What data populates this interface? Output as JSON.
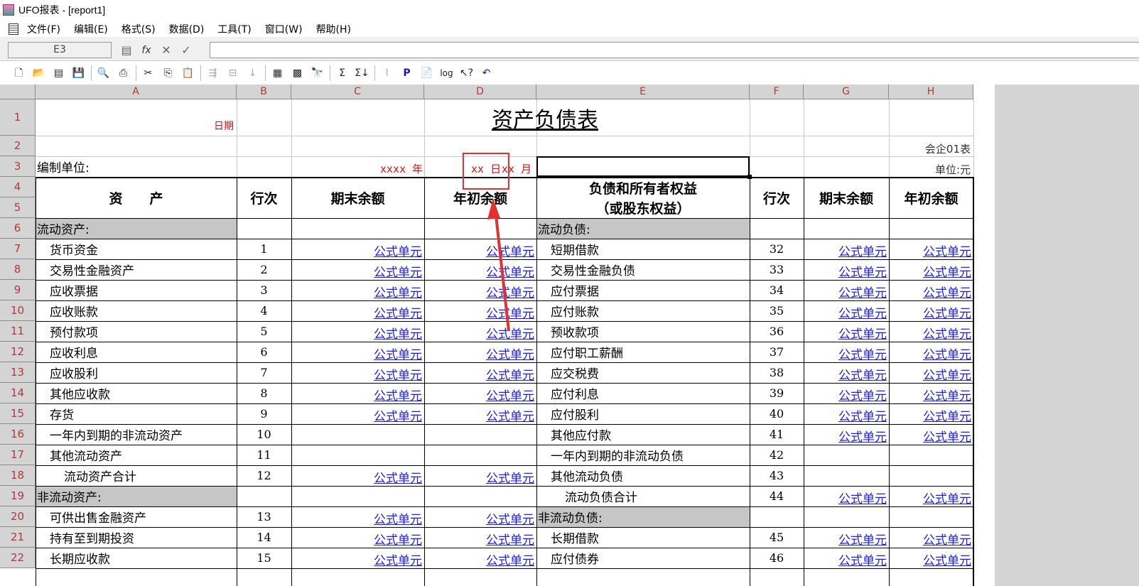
{
  "window": {
    "title": "UFO报表 - [report1]"
  },
  "menu": [
    "文件(F)",
    "编辑(E)",
    "格式(S)",
    "数据(D)",
    "工具(T)",
    "窗口(W)",
    "帮助(H)"
  ],
  "formula_bar": {
    "cell_ref": "E3",
    "fx": "fx",
    "value": ""
  },
  "columns": [
    "A",
    "B",
    "C",
    "D",
    "E",
    "F",
    "G",
    "H"
  ],
  "rows": [
    "1",
    "2",
    "3",
    "4",
    "5",
    "6",
    "7",
    "8",
    "9",
    "10",
    "11",
    "12",
    "13",
    "14",
    "15",
    "16",
    "17",
    "18",
    "19",
    "20",
    "21",
    "22"
  ],
  "report": {
    "title": "资产负债表",
    "date_label": "日期",
    "form_no": "会企01表",
    "unit_label": "编制单位:",
    "currency_unit": "单位:元",
    "date_parts": [
      "xxxx 年",
      "xx 日",
      "xx 月"
    ],
    "headers": {
      "assets": "资　　产",
      "row_no": "行次",
      "end_balance": "期末余额",
      "begin_balance": "年初余额",
      "liab_line1": "负债和所有者权益",
      "liab_line2": "（或股东权益）"
    },
    "formula_text": "公式单元",
    "left_items": [
      {
        "name": "流动资产:",
        "no": "",
        "f": false,
        "sec": true
      },
      {
        "name": "货币资金",
        "no": "1",
        "f": true
      },
      {
        "name": "交易性金融资产",
        "no": "2",
        "f": true
      },
      {
        "name": "应收票据",
        "no": "3",
        "f": true
      },
      {
        "name": "应收账款",
        "no": "4",
        "f": true
      },
      {
        "name": "预付款项",
        "no": "5",
        "f": true
      },
      {
        "name": "应收利息",
        "no": "6",
        "f": true
      },
      {
        "name": "应收股利",
        "no": "7",
        "f": true
      },
      {
        "name": "其他应收款",
        "no": "8",
        "f": true
      },
      {
        "name": "存货",
        "no": "9",
        "f": true
      },
      {
        "name": "一年内到期的非流动资产",
        "no": "10",
        "f": false
      },
      {
        "name": "其他流动资产",
        "no": "11",
        "f": false
      },
      {
        "name": "流动资产合计",
        "no": "12",
        "f": true,
        "indent2": true
      },
      {
        "name": "非流动资产:",
        "no": "",
        "f": false,
        "sec": true
      },
      {
        "name": "可供出售金融资产",
        "no": "13",
        "f": true
      },
      {
        "name": "持有至到期投资",
        "no": "14",
        "f": true
      },
      {
        "name": "长期应收款",
        "no": "15",
        "f": true
      }
    ],
    "right_items": [
      {
        "name": "流动负债:",
        "no": "",
        "f": false,
        "sec": true
      },
      {
        "name": "短期借款",
        "no": "32",
        "f": true
      },
      {
        "name": "交易性金融负债",
        "no": "33",
        "f": true
      },
      {
        "name": "应付票据",
        "no": "34",
        "f": true
      },
      {
        "name": "应付账款",
        "no": "35",
        "f": true
      },
      {
        "name": "预收款项",
        "no": "36",
        "f": true
      },
      {
        "name": "应付职工薪酬",
        "no": "37",
        "f": true
      },
      {
        "name": "应交税费",
        "no": "38",
        "f": true
      },
      {
        "name": "应付利息",
        "no": "39",
        "f": true
      },
      {
        "name": "应付股利",
        "no": "40",
        "f": true
      },
      {
        "name": "其他应付款",
        "no": "41",
        "f": true
      },
      {
        "name": "一年内到期的非流动负债",
        "no": "42",
        "f": false
      },
      {
        "name": "其他流动负债",
        "no": "43",
        "f": false
      },
      {
        "name": "流动负债合计",
        "no": "44",
        "f": true,
        "indent2": true
      },
      {
        "name": "非流动负债:",
        "no": "",
        "f": false,
        "sec": true
      },
      {
        "name": "长期借款",
        "no": "45",
        "f": true
      },
      {
        "name": "应付债券",
        "no": "46",
        "f": true
      }
    ]
  },
  "colors": {
    "header_bg": "#d4d4d4",
    "header_text": "#b03838",
    "formula": "#1c1cf0",
    "date": "#e01010",
    "annotation": "#e53030"
  }
}
